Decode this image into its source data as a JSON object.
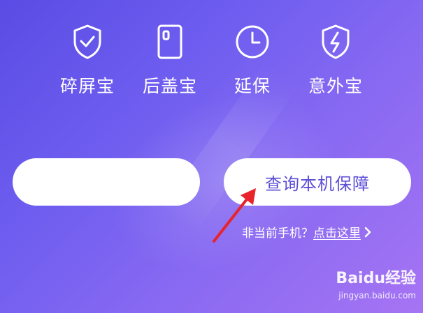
{
  "services": [
    {
      "label": "碎屏宝",
      "icon": "shield-check-icon"
    },
    {
      "label": "后盖宝",
      "icon": "phone-back-icon"
    },
    {
      "label": "延保",
      "icon": "clock-icon"
    },
    {
      "label": "意外宝",
      "icon": "shield-bolt-icon"
    }
  ],
  "query_button": {
    "label": "查询本机保障"
  },
  "switch_device": {
    "question": "非当前手机？",
    "link": "点击这里",
    "icon": "chevron-right-icon"
  },
  "annotation": {
    "arrow_color": "#e8232b"
  },
  "watermark": {
    "brand": "Baidu经验",
    "url": "jingyan.baidu.com"
  },
  "colors": {
    "accent": "#5d4fd6",
    "background_start": "#5a4ce4",
    "background_end": "#a674f3"
  }
}
